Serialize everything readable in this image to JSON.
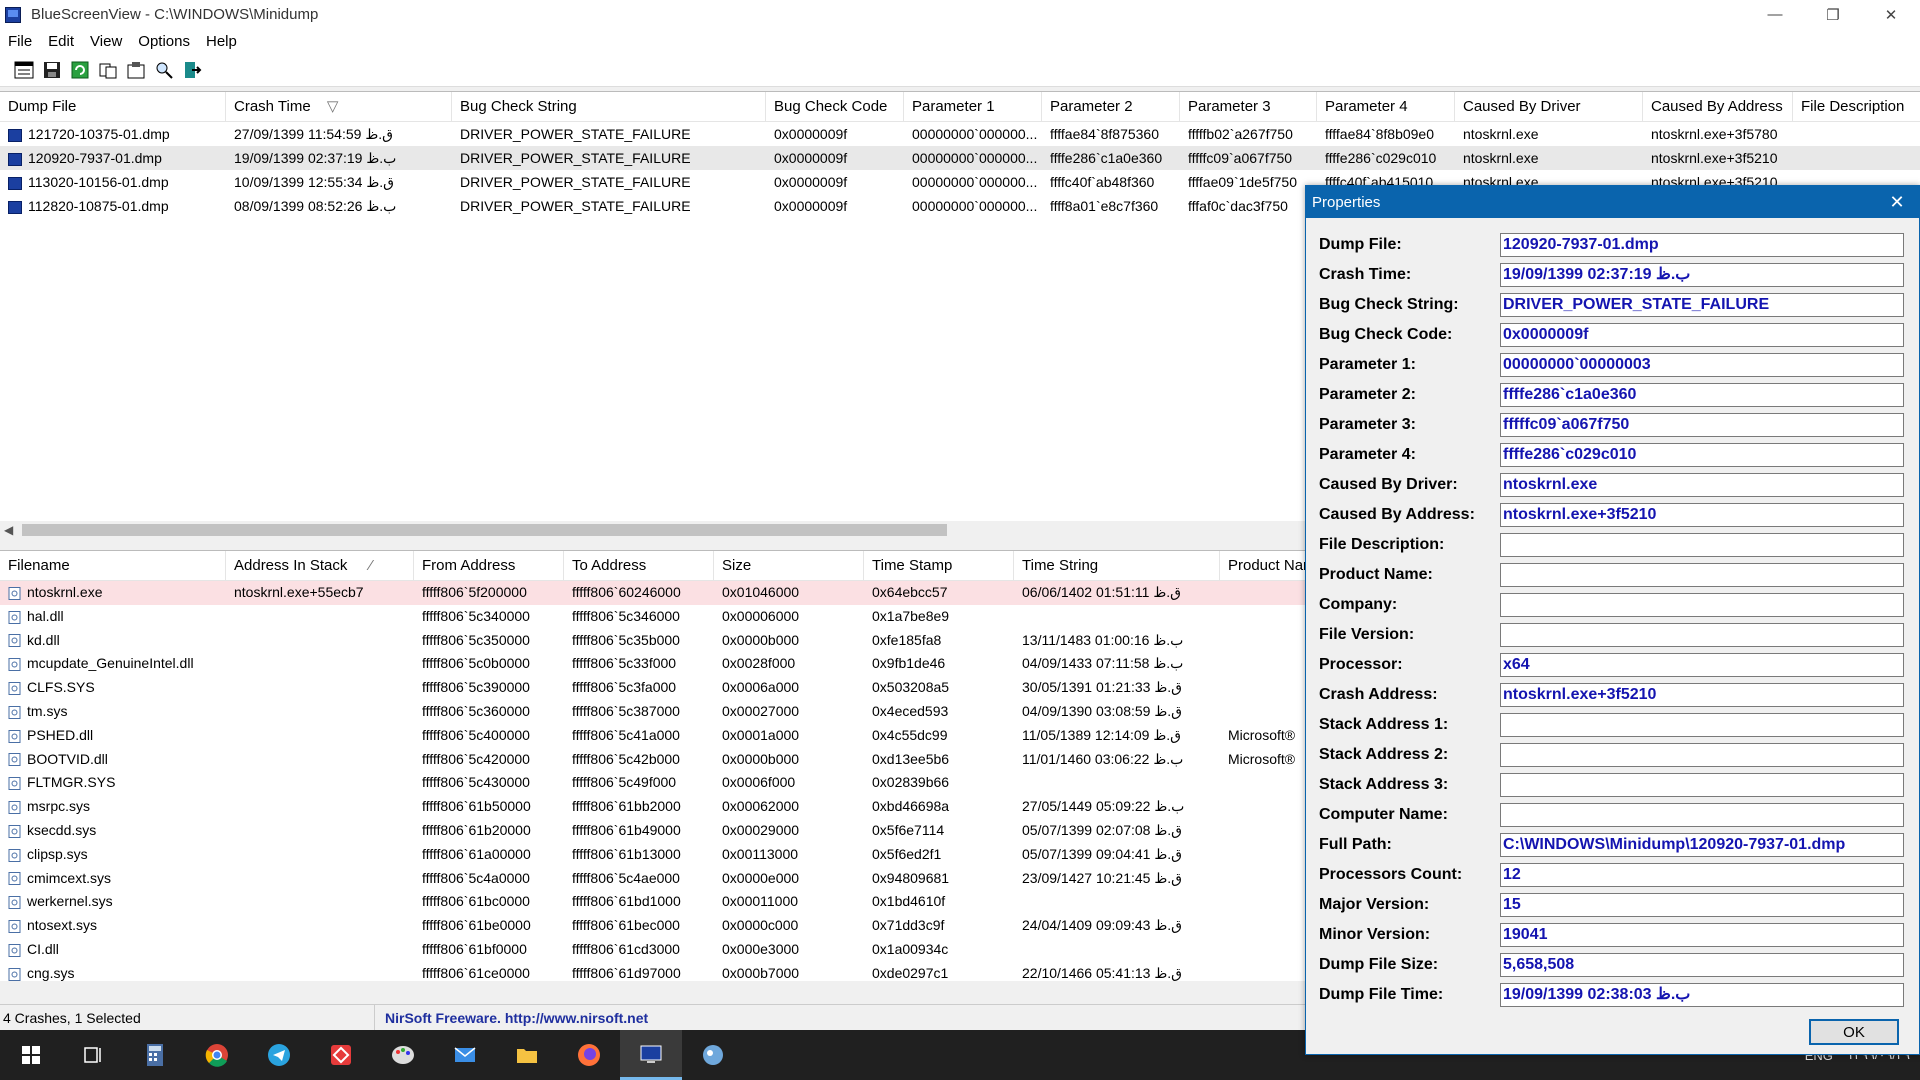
{
  "window": {
    "title": "BlueScreenView  -  C:\\WINDOWS\\Minidump",
    "min_glyph": "—",
    "restore_glyph": "❐",
    "close_glyph": "✕"
  },
  "menu": [
    "File",
    "Edit",
    "View",
    "Options",
    "Help"
  ],
  "toolbar_icons": [
    "properties-icon",
    "save-icon",
    "refresh-icon",
    "copy-icon",
    "options-icon",
    "find-icon",
    "exit-icon"
  ],
  "crashes": {
    "columns": [
      "Dump File",
      "Crash Time",
      "Bug Check String",
      "Bug Check Code",
      "Parameter 1",
      "Parameter 2",
      "Parameter 3",
      "Parameter 4",
      "Caused By Driver",
      "Caused By Address",
      "File Description"
    ],
    "sort_glyph": "▽",
    "rows": [
      [
        "121720-10375-01.dmp",
        "27/09/1399 11:54:59 ق.ظ",
        "DRIVER_POWER_STATE_FAILURE",
        "0x0000009f",
        "00000000`000000...",
        "ffffae84`8f875360",
        "fffffb02`a267f750",
        "ffffae84`8f8b09e0",
        "ntoskrnl.exe",
        "ntoskrnl.exe+3f5780",
        ""
      ],
      [
        "120920-7937-01.dmp",
        "19/09/1399 02:37:19 ب.ظ",
        "DRIVER_POWER_STATE_FAILURE",
        "0x0000009f",
        "00000000`000000...",
        "ffffe286`c1a0e360",
        "fffffc09`a067f750",
        "ffffe286`c029c010",
        "ntoskrnl.exe",
        "ntoskrnl.exe+3f5210",
        ""
      ],
      [
        "113020-10156-01.dmp",
        "10/09/1399 12:55:34 ق.ظ",
        "DRIVER_POWER_STATE_FAILURE",
        "0x0000009f",
        "00000000`000000...",
        "ffffc40f`ab48f360",
        "ffffae09`1de5f750",
        "ffffc40f`ab415010",
        "ntoskrnl.exe",
        "ntoskrnl.exe+3f5210",
        ""
      ],
      [
        "112820-10875-01.dmp",
        "08/09/1399 08:52:26 ب.ظ",
        "DRIVER_POWER_STATE_FAILURE",
        "0x0000009f",
        "00000000`000000...",
        "ffff8a01`e8c7f360",
        "fffaf0c`dac3f750",
        "",
        "",
        "",
        ""
      ]
    ]
  },
  "drivers": {
    "columns": [
      "Filename",
      "Address In Stack",
      "From Address",
      "To Address",
      "Size",
      "Time Stamp",
      "Time String",
      "Product Nar"
    ],
    "sort_glyph": "⁄",
    "rows": [
      [
        "ntoskrnl.exe",
        "ntoskrnl.exe+55ecb7",
        "fffff806`5f200000",
        "fffff806`60246000",
        "0x01046000",
        "0x64ebcc57",
        "06/06/1402 01:51:11 ق.ظ",
        ""
      ],
      [
        "hal.dll",
        "",
        "fffff806`5c340000",
        "fffff806`5c346000",
        "0x00006000",
        "0x1a7be8e9",
        "",
        ""
      ],
      [
        "kd.dll",
        "",
        "fffff806`5c350000",
        "fffff806`5c35b000",
        "0x0000b000",
        "0xfe185fa8",
        "13/11/1483 01:00:16 ب.ظ",
        ""
      ],
      [
        "mcupdate_GenuineIntel.dll",
        "",
        "fffff806`5c0b0000",
        "fffff806`5c33f000",
        "0x0028f000",
        "0x9fb1de46",
        "04/09/1433 07:11:58 ب.ظ",
        ""
      ],
      [
        "CLFS.SYS",
        "",
        "fffff806`5c390000",
        "fffff806`5c3fa000",
        "0x0006a000",
        "0x503208a5",
        "30/05/1391 01:21:33 ق.ظ",
        ""
      ],
      [
        "tm.sys",
        "",
        "fffff806`5c360000",
        "fffff806`5c387000",
        "0x00027000",
        "0x4eced593",
        "04/09/1390 03:08:59 ق.ظ",
        ""
      ],
      [
        "PSHED.dll",
        "",
        "fffff806`5c400000",
        "fffff806`5c41a000",
        "0x0001a000",
        "0x4c55dc99",
        "11/05/1389 12:14:09 ق.ظ",
        "Microsoft®"
      ],
      [
        "BOOTVID.dll",
        "",
        "fffff806`5c420000",
        "fffff806`5c42b000",
        "0x0000b000",
        "0xd13ee5b6",
        "11/01/1460 03:06:22 ب.ظ",
        "Microsoft®"
      ],
      [
        "FLTMGR.SYS",
        "",
        "fffff806`5c430000",
        "fffff806`5c49f000",
        "0x0006f000",
        "0x02839b66",
        "",
        ""
      ],
      [
        "msrpc.sys",
        "",
        "fffff806`61b50000",
        "fffff806`61bb2000",
        "0x00062000",
        "0xbd46698a",
        "27/05/1449 05:09:22 ب.ظ",
        ""
      ],
      [
        "ksecdd.sys",
        "",
        "fffff806`61b20000",
        "fffff806`61b49000",
        "0x00029000",
        "0x5f6e7114",
        "05/07/1399 02:07:08 ق.ظ",
        ""
      ],
      [
        "clipsp.sys",
        "",
        "fffff806`61a00000",
        "fffff806`61b13000",
        "0x00113000",
        "0x5f6ed2f1",
        "05/07/1399 09:04:41 ق.ظ",
        ""
      ],
      [
        "cmimcext.sys",
        "",
        "fffff806`5c4a0000",
        "fffff806`5c4ae000",
        "0x0000e000",
        "0x94809681",
        "23/09/1427 10:21:45 ق.ظ",
        ""
      ],
      [
        "werkernel.sys",
        "",
        "fffff806`61bc0000",
        "fffff806`61bd1000",
        "0x00011000",
        "0x1bd4610f",
        "",
        ""
      ],
      [
        "ntosext.sys",
        "",
        "fffff806`61be0000",
        "fffff806`61bec000",
        "0x0000c000",
        "0x71dd3c9f",
        "24/04/1409 09:09:43 ق.ظ",
        ""
      ],
      [
        "CI.dll",
        "",
        "fffff806`61bf0000",
        "fffff806`61cd3000",
        "0x000e3000",
        "0x1a00934c",
        "",
        ""
      ],
      [
        "cng.sys",
        "",
        "fffff806`61ce0000",
        "fffff806`61d97000",
        "0x000b7000",
        "0xde0297c1",
        "22/10/1466 05:41:13 ق.ظ",
        ""
      ]
    ]
  },
  "status": {
    "count": "4 Crashes, 1 Selected",
    "link": "NirSoft Freeware.  http://www.nirsoft.net"
  },
  "properties": {
    "title": "Properties",
    "close_glyph": "✕",
    "ok_label": "OK",
    "fields": [
      {
        "label": "Dump File:",
        "value": "120920-7937-01.dmp"
      },
      {
        "label": "Crash Time:",
        "value": "19/09/1399 02:37:19 ب.ظ"
      },
      {
        "label": "Bug Check String:",
        "value": "DRIVER_POWER_STATE_FAILURE"
      },
      {
        "label": "Bug Check Code:",
        "value": "0x0000009f"
      },
      {
        "label": "Parameter 1:",
        "value": "00000000`00000003"
      },
      {
        "label": "Parameter 2:",
        "value": "ffffe286`c1a0e360"
      },
      {
        "label": "Parameter 3:",
        "value": "fffffc09`a067f750"
      },
      {
        "label": "Parameter 4:",
        "value": "ffffe286`c029c010"
      },
      {
        "label": "Caused By Driver:",
        "value": "ntoskrnl.exe"
      },
      {
        "label": "Caused By Address:",
        "value": "ntoskrnl.exe+3f5210"
      },
      {
        "label": "File Description:",
        "value": ""
      },
      {
        "label": "Product Name:",
        "value": ""
      },
      {
        "label": "Company:",
        "value": ""
      },
      {
        "label": "File Version:",
        "value": ""
      },
      {
        "label": "Processor:",
        "value": "x64"
      },
      {
        "label": "Crash Address:",
        "value": "ntoskrnl.exe+3f5210"
      },
      {
        "label": "Stack Address 1:",
        "value": ""
      },
      {
        "label": "Stack Address 2:",
        "value": ""
      },
      {
        "label": "Stack Address 3:",
        "value": ""
      },
      {
        "label": "Computer Name:",
        "value": ""
      },
      {
        "label": "Full Path:",
        "value": "C:\\WINDOWS\\Minidump\\120920-7937-01.dmp"
      },
      {
        "label": "Processors Count:",
        "value": "12"
      },
      {
        "label": "Major Version:",
        "value": "15"
      },
      {
        "label": "Minor Version:",
        "value": "19041"
      },
      {
        "label": "Dump File Size:",
        "value": "5,658,508"
      },
      {
        "label": "Dump File Time:",
        "value": "19/09/1399 02:38:03 ب.ظ"
      }
    ]
  },
  "taskbar": {
    "icons": [
      "windows-start-icon",
      "task-view-icon",
      "calculator-icon",
      "chrome-icon",
      "telegram-icon",
      "anydesk-icon",
      "paint-icon",
      "mail-icon",
      "file-explorer-icon",
      "firefox-icon",
      "bluescreenview-icon",
      "app-icon"
    ],
    "tray_lang": "ENG",
    "tray_date": "۱۳۹۹/۰۹/۲۹"
  },
  "colors": {
    "accent": "#0a64ad",
    "value_text": "#1414b0",
    "highlight_row": "#fbe0e3",
    "selected_row": "#e8e8e8",
    "taskbar": "#202020"
  }
}
